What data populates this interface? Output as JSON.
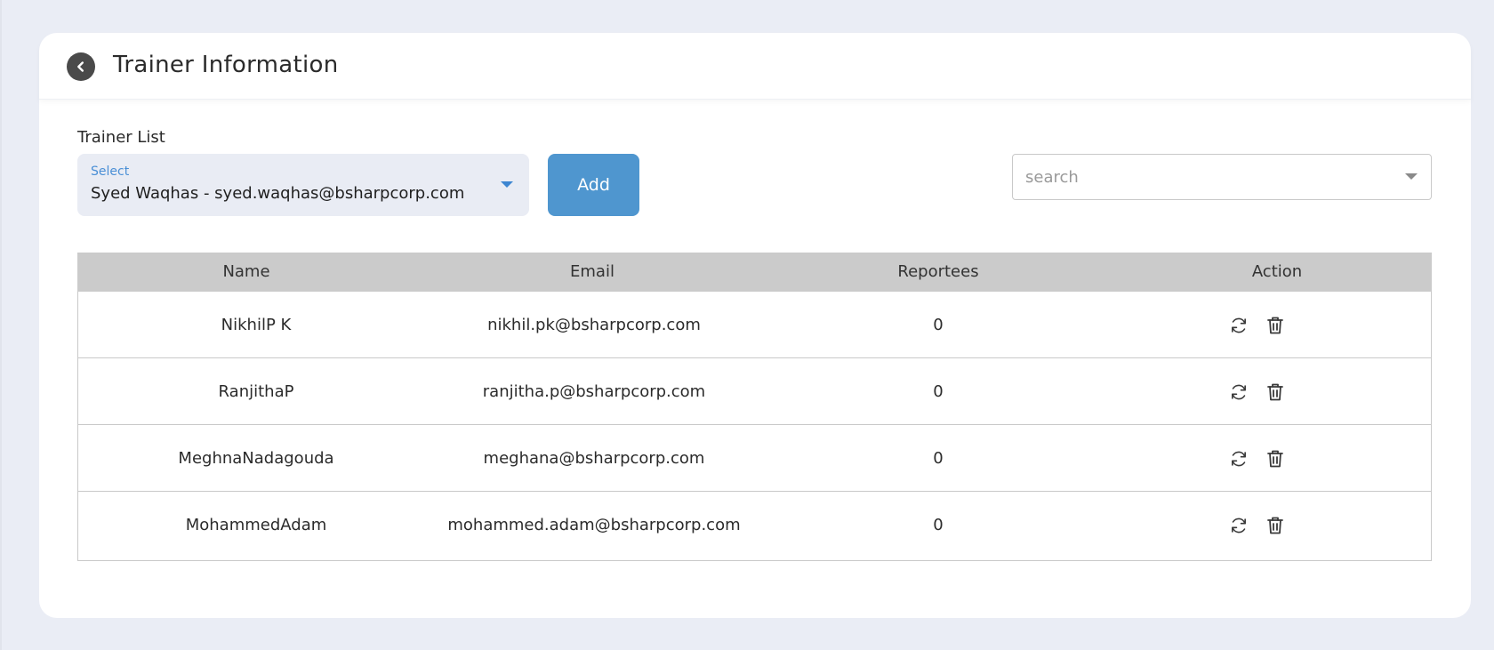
{
  "header": {
    "title": "Trainer Information"
  },
  "trainer_select": {
    "section_label": "Trainer List",
    "field_label": "Select",
    "value": "Syed Waqhas - syed.waqhas@bsharpcorp.com"
  },
  "add_button": {
    "label": "Add"
  },
  "search": {
    "placeholder": "search",
    "value": ""
  },
  "table": {
    "columns": [
      "Name",
      "Email",
      "Reportees",
      "Action"
    ],
    "rows": [
      {
        "name": "NikhilP K",
        "email": "nikhil.pk@bsharpcorp.com",
        "reportees": "0"
      },
      {
        "name": "RanjithaP",
        "email": "ranjitha.p@bsharpcorp.com",
        "reportees": "0"
      },
      {
        "name": "MeghnaNadagouda",
        "email": "meghana@bsharpcorp.com",
        "reportees": "0"
      },
      {
        "name": "MohammedAdam",
        "email": "mohammed.adam@bsharpcorp.com",
        "reportees": "0"
      }
    ]
  },
  "icons": {
    "back": "chevron-left-icon",
    "refresh": "refresh-icon",
    "delete": "trash-icon"
  },
  "colors": {
    "accent": "#4f96cf",
    "select_label": "#4a8fd6",
    "table_header_bg": "#cbcbcb",
    "page_bg": "#eaedf5"
  }
}
